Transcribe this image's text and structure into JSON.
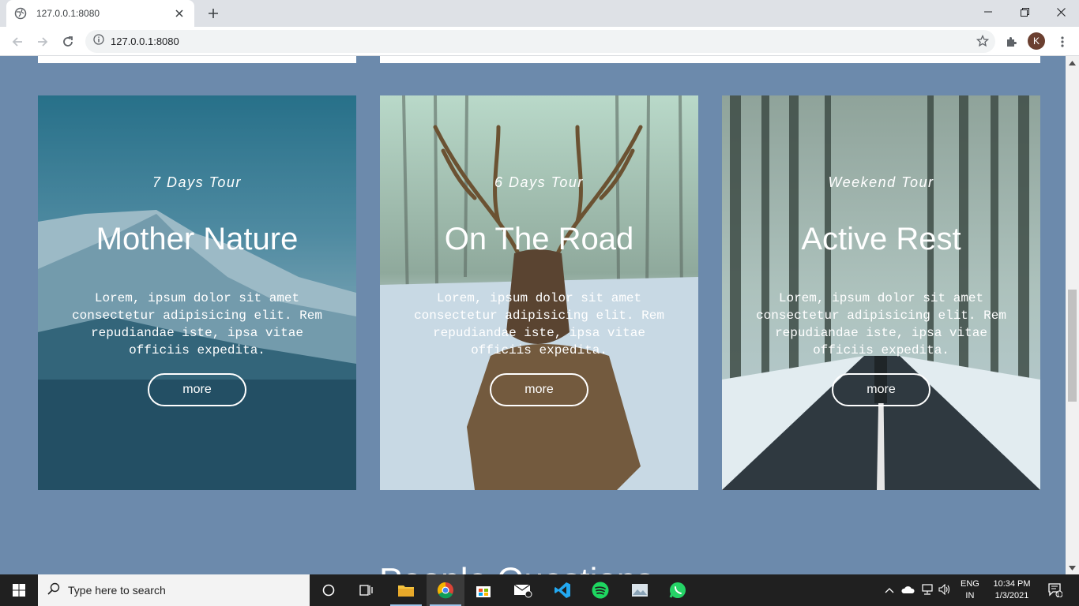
{
  "browser": {
    "tab_title": "127.0.0.1:8080",
    "url": "127.0.0.1:8080",
    "profile_initial": "K"
  },
  "cards": [
    {
      "subtitle": "7 Days Tour",
      "heading": "Mother Nature",
      "description": "Lorem, ipsum dolor sit amet consectetur adipisicing elit. Rem repudiandae iste, ipsa vitae officiis expedita.",
      "button": "more"
    },
    {
      "subtitle": "6 Days Tour",
      "heading": "On The Road",
      "description": "Lorem, ipsum dolor sit amet consectetur adipisicing elit. Rem repudiandae iste, ipsa vitae officiis expedita.",
      "button": "more"
    },
    {
      "subtitle": "Weekend Tour",
      "heading": "Active Rest",
      "description": "Lorem, ipsum dolor sit amet consectetur adipisicing elit. Rem repudiandae iste, ipsa vitae officiis expedita.",
      "button": "more"
    }
  ],
  "next_section_title": "People Questions",
  "taskbar": {
    "search_placeholder": "Type here to search",
    "lang_top": "ENG",
    "lang_bottom": "IN",
    "time": "10:34 PM",
    "date": "1/3/2021",
    "notification_count": "1"
  },
  "colors": {
    "page_bg": "#6c8aac",
    "taskbar_bg": "#202020"
  }
}
